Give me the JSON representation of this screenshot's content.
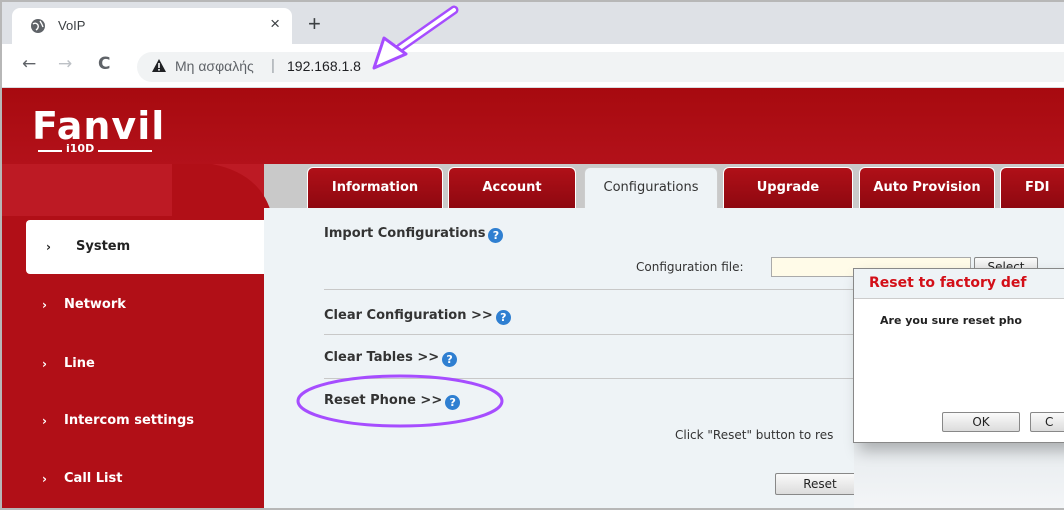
{
  "browser": {
    "tab_title": "VoIP",
    "tab_close": "×",
    "new_tab": "+",
    "back": "←",
    "forward": "→",
    "reload": "C",
    "security_text": "Μη ασφαλής",
    "separator": "|",
    "url": "192.168.1.8"
  },
  "brand": {
    "logo": "Fanvil",
    "model": "i10D"
  },
  "main_tabs": [
    {
      "label": "Information"
    },
    {
      "label": "Account"
    },
    {
      "label": "Configurations"
    },
    {
      "label": "Upgrade"
    },
    {
      "label": "Auto Provision"
    },
    {
      "label": "FDI"
    }
  ],
  "sidebar": {
    "chevron": "›",
    "items": [
      {
        "label": "System"
      },
      {
        "label": "Network"
      },
      {
        "label": "Line"
      },
      {
        "label": "Intercom settings"
      },
      {
        "label": "Call List"
      }
    ]
  },
  "content": {
    "import_title": "Import Configurations",
    "config_file_label": "Configuration file:",
    "select_label": "Select",
    "clear_config": "Clear Configuration >>",
    "clear_tables": "Clear Tables >>",
    "reset_phone": "Reset Phone >>",
    "reset_hint": "Click \"Reset\" button to res",
    "reset_button": "Reset",
    "help_glyph": "?"
  },
  "dialog": {
    "title": "Reset to factory def",
    "message": "Are you sure reset pho",
    "ok": "OK",
    "cancel": "C"
  },
  "colors": {
    "brand_red": "#b10f17",
    "annotation_purple": "#a64dff"
  }
}
